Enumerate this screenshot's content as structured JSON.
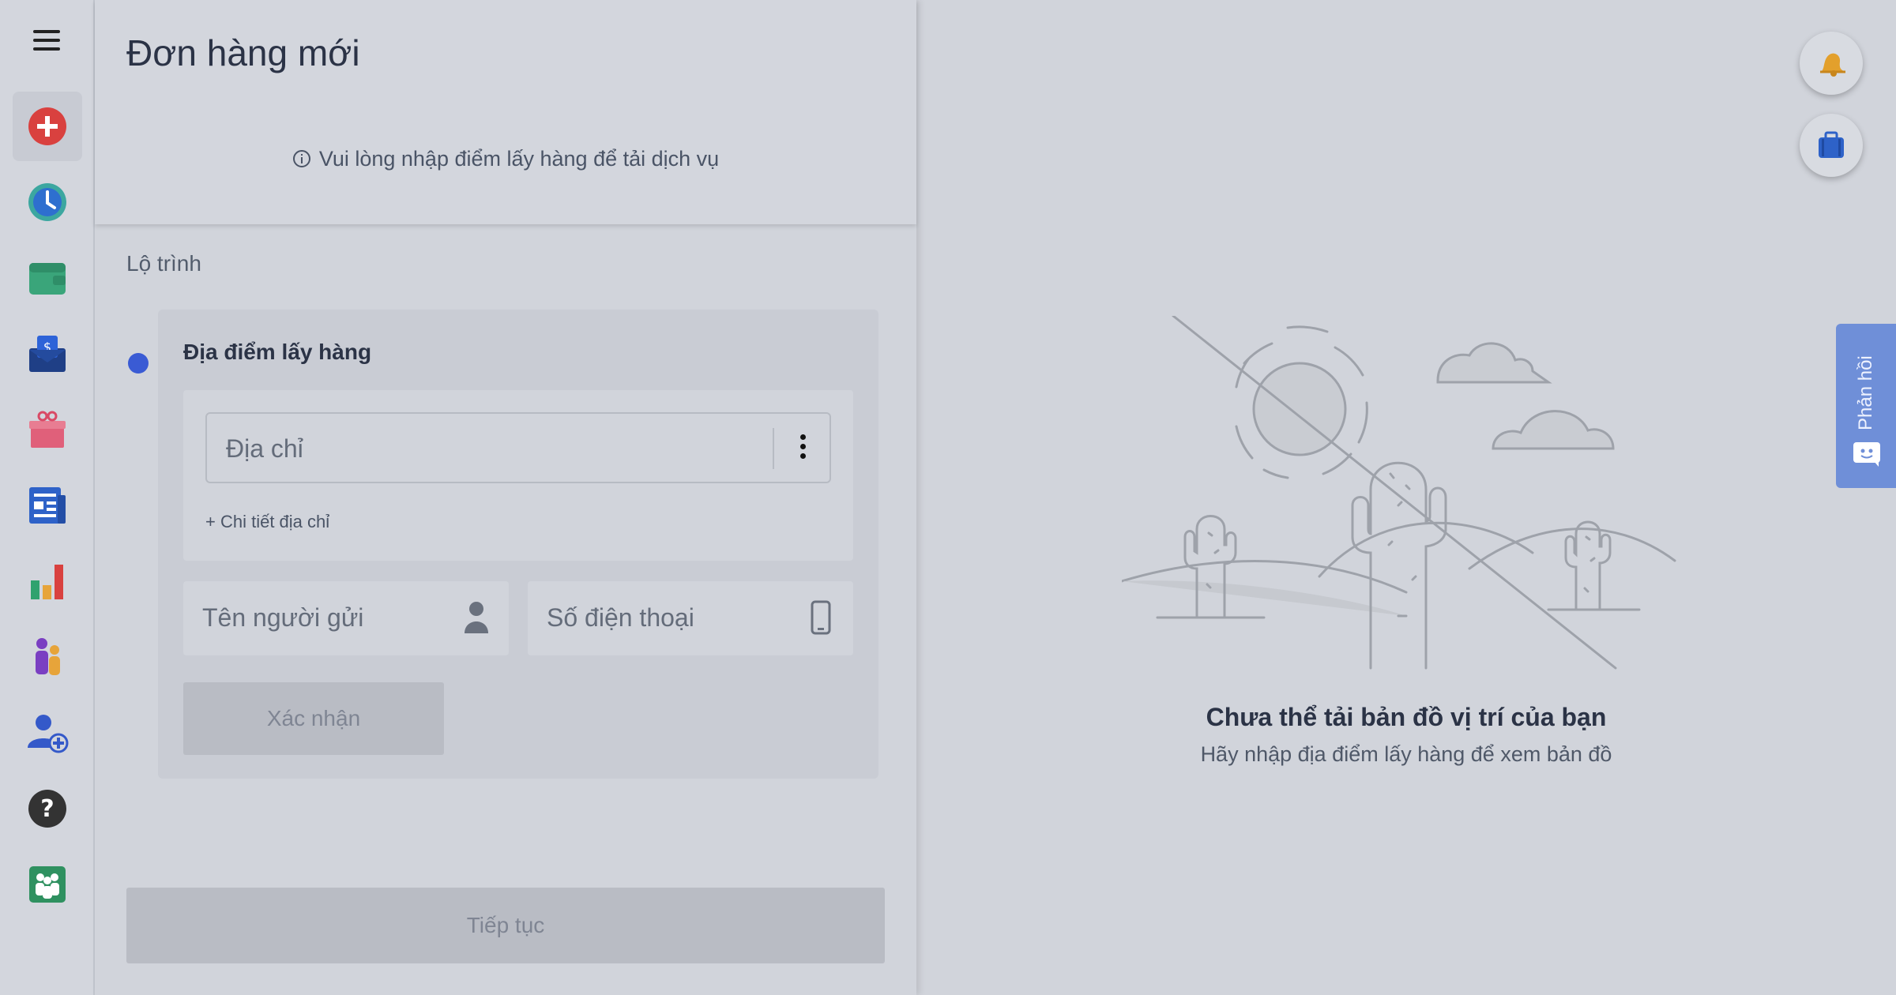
{
  "header": {
    "title": "Đơn hàng mới",
    "notice": "Vui lòng nhập điểm lấy hàng để tải dịch vụ"
  },
  "sidebar": {
    "items": [
      {
        "icon": "plus-circle-icon",
        "active": true
      },
      {
        "icon": "clock-icon"
      },
      {
        "icon": "wallet-icon"
      },
      {
        "icon": "money-envelope-icon"
      },
      {
        "icon": "gift-icon"
      },
      {
        "icon": "news-icon"
      },
      {
        "icon": "bar-chart-icon"
      },
      {
        "icon": "people-icon"
      },
      {
        "icon": "add-user-icon"
      },
      {
        "icon": "help-icon"
      },
      {
        "icon": "team-icon"
      }
    ]
  },
  "route": {
    "label": "Lộ trình",
    "pickup_title": "Địa điểm lấy hàng",
    "address_placeholder": "Địa chỉ",
    "address_detail_link": "+ Chi tiết địa chỉ",
    "sender_placeholder": "Tên người gửi",
    "phone_placeholder": "Số điện thoại",
    "confirm_label": "Xác nhận"
  },
  "footer": {
    "continue_label": "Tiếp tục"
  },
  "map": {
    "error_title": "Chưa thể tải bản đồ vị trí của bạn",
    "error_subtitle": "Hãy nhập địa điểm lấy hàng để xem bản đồ"
  },
  "feedback": {
    "label": "Phản hồi"
  },
  "colors": {
    "accent": "#3a5bd4",
    "feedback": "#6f8fd8",
    "background": "#d1d4db"
  }
}
